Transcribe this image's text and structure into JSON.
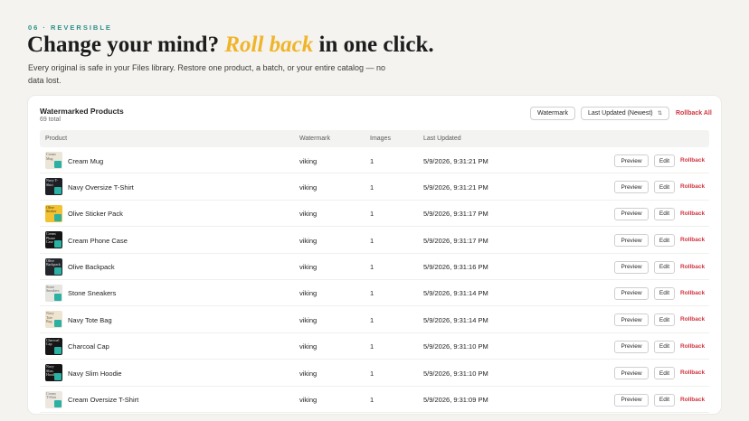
{
  "section": {
    "eyebrow": "06 · REVERSIBLE",
    "headline_pre": "Change your mind?",
    "headline_accent": "Roll back",
    "headline_post": "in one click.",
    "subtext": "Every original is safe in your Files library. Restore one product, a batch, or your entire catalog — no data lost."
  },
  "colors": {
    "eyebrow": "#2b8f8a",
    "accent": "#f0b429",
    "danger": "#d0343f",
    "watermark_badge": "#2bb0a4"
  },
  "card": {
    "title": "Watermarked Products",
    "count": "69 total",
    "watermark_button": "Watermark",
    "sort_select": "Last Updated (Newest)",
    "sort_icon": "updown-chevron-icon",
    "rollback_all": "Rollback All"
  },
  "table": {
    "headers": [
      "Product",
      "Watermark",
      "Images",
      "Last Updated"
    ],
    "actions": {
      "preview": "Preview",
      "edit": "Edit",
      "rollback": "Rollback"
    },
    "rows": [
      {
        "name": "Cream Mug",
        "watermark": "viking",
        "images": "1",
        "updated": "5/9/2026, 9:31:21 PM",
        "thumb_bg": "#ece6d8",
        "thumb_text": "Cream Mug",
        "thumb_fg": "#6b6458"
      },
      {
        "name": "Navy Oversize T-Shirt",
        "watermark": "viking",
        "images": "1",
        "updated": "5/9/2026, 9:31:21 PM",
        "thumb_bg": "#1d1f24",
        "thumb_text": "Navy T-Shirt",
        "thumb_fg": "#e8e8e8"
      },
      {
        "name": "Olive Sticker Pack",
        "watermark": "viking",
        "images": "1",
        "updated": "5/9/2026, 9:31:17 PM",
        "thumb_bg": "#f2c232",
        "thumb_text": "Olive Sticker",
        "thumb_fg": "#3a3218"
      },
      {
        "name": "Cream Phone Case",
        "watermark": "viking",
        "images": "1",
        "updated": "5/9/2026, 9:31:17 PM",
        "thumb_bg": "#141414",
        "thumb_text": "Cream Phone Case",
        "thumb_fg": "#e0e0e0"
      },
      {
        "name": "Olive Backpack",
        "watermark": "viking",
        "images": "1",
        "updated": "5/9/2026, 9:31:16 PM",
        "thumb_bg": "#23262c",
        "thumb_text": "Olive Backpack",
        "thumb_fg": "#e4e4e4"
      },
      {
        "name": "Stone Sneakers",
        "watermark": "viking",
        "images": "1",
        "updated": "5/9/2026, 9:31:14 PM",
        "thumb_bg": "#e7e5e0",
        "thumb_text": "Stone Sneakers",
        "thumb_fg": "#6a6a6a"
      },
      {
        "name": "Navy Tote Bag",
        "watermark": "viking",
        "images": "1",
        "updated": "5/9/2026, 9:31:14 PM",
        "thumb_bg": "#efe4cf",
        "thumb_text": "Navy Tote Bag",
        "thumb_fg": "#6a604c"
      },
      {
        "name": "Charcoal Cap",
        "watermark": "viking",
        "images": "1",
        "updated": "5/9/2026, 9:31:10 PM",
        "thumb_bg": "#161616",
        "thumb_text": "Charcoal Cap",
        "thumb_fg": "#e0e0e0"
      },
      {
        "name": "Navy Slim Hoodie",
        "watermark": "viking",
        "images": "1",
        "updated": "5/9/2026, 9:31:10 PM",
        "thumb_bg": "#141414",
        "thumb_text": "Navy Slim Hoodie",
        "thumb_fg": "#e0e0e0"
      },
      {
        "name": "Cream Oversize T-Shirt",
        "watermark": "viking",
        "images": "1",
        "updated": "5/9/2026, 9:31:09 PM",
        "thumb_bg": "#ece8e0",
        "thumb_text": "Cream T-Shirt",
        "thumb_fg": "#6a6a6a"
      }
    ]
  }
}
